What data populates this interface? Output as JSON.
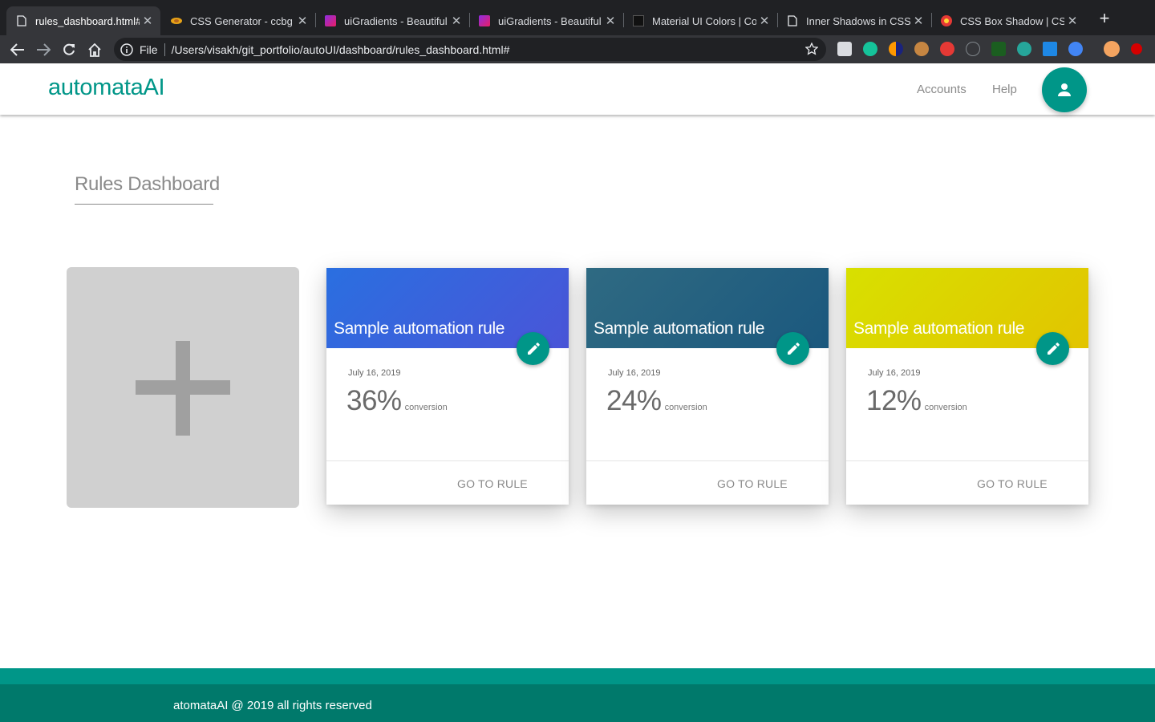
{
  "browser": {
    "tabs": [
      {
        "title": "rules_dashboard.html#",
        "active": true,
        "favicon": "document-icon"
      },
      {
        "title": "CSS Generator - ccbg",
        "active": false,
        "favicon": "css-generator-icon"
      },
      {
        "title": "uiGradients - Beautiful",
        "active": false,
        "favicon": "uigradients-icon"
      },
      {
        "title": "uiGradients - Beautiful",
        "active": false,
        "favicon": "uigradients-icon"
      },
      {
        "title": "Material UI Colors | Co",
        "active": false,
        "favicon": "material-colors-icon"
      },
      {
        "title": "Inner Shadows in CSS",
        "active": false,
        "favicon": "document-icon"
      },
      {
        "title": "CSS Box Shadow | CSS",
        "active": false,
        "favicon": "box-shadow-icon"
      }
    ],
    "address": {
      "scheme": "File",
      "url": "/Users/visakh/git_portfolio/autoUI/dashboard/rules_dashboard.html#"
    }
  },
  "header": {
    "brand": "automataAI",
    "nav": [
      "Accounts",
      "Help"
    ]
  },
  "page": {
    "title": "Rules Dashboard"
  },
  "cards": [
    {
      "title": "Sample automation rule",
      "date": "July 16, 2019",
      "value": "36%",
      "unit": "conversion",
      "action": "GO TO RULE",
      "gradient": [
        "#2a6fe0",
        "#4a55d8"
      ]
    },
    {
      "title": "Sample automation rule",
      "date": "July 16, 2019",
      "value": "24%",
      "unit": "conversion",
      "action": "GO TO RULE",
      "gradient": [
        "#2f6a82",
        "#1b587e"
      ]
    },
    {
      "title": "Sample automation rule",
      "date": "July 16, 2019",
      "value": "12%",
      "unit": "conversion",
      "action": "GO TO RULE",
      "gradient": [
        "#d8e000",
        "#e2c400"
      ]
    }
  ],
  "footer": {
    "text": "atomataAI @ 2019 all rights reserved"
  },
  "colors": {
    "accent": "#009688",
    "footer_dark": "#00796b"
  }
}
